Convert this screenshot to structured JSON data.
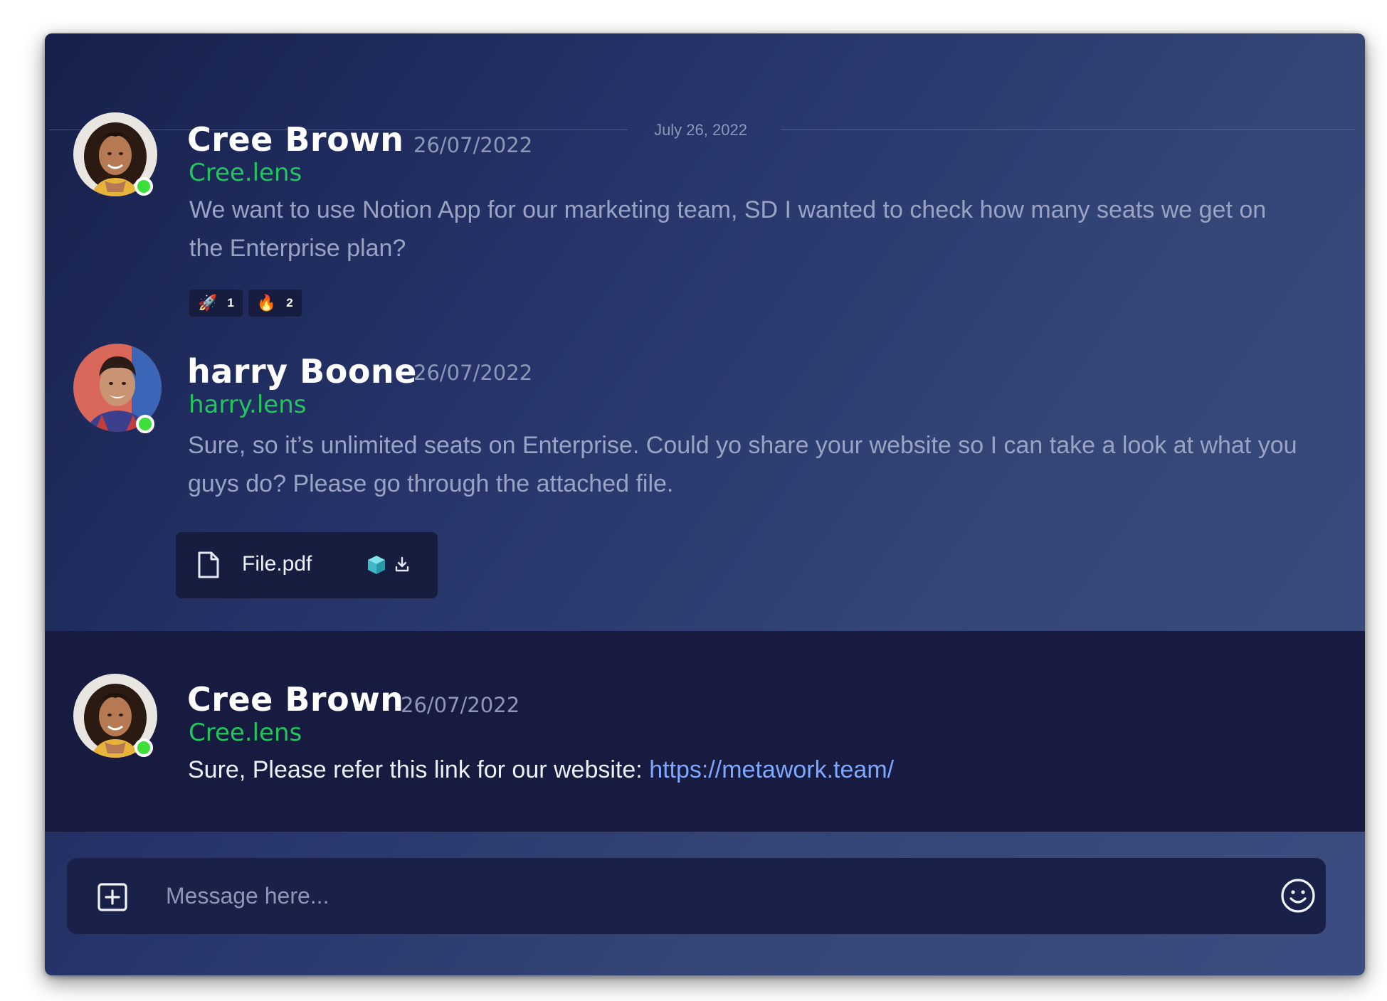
{
  "date_divider": "July 26, 2022",
  "messages": [
    {
      "name": "Cree Brown",
      "date": "26/07/2022",
      "handle": "Cree.lens",
      "text": "We want to use Notion App for our marketing team, SD I wanted to check how many seats we get on the Enterprise plan?",
      "online": true,
      "reactions": [
        {
          "emoji": "🚀",
          "icon": "rocket-icon",
          "count": "1"
        },
        {
          "emoji": "🔥",
          "icon": "fire-icon",
          "count": "2"
        }
      ]
    },
    {
      "name": "harry Boone",
      "date": "26/07/2022",
      "handle": "harry.lens",
      "text": "Sure, so it’s unlimited seats on Enterprise. Could yo share your website so I can take a look at what you guys do? Please go through the attached file.",
      "online": true,
      "attachment": {
        "file_name": "File.pdf",
        "file_icon": "document-icon",
        "cube_icon": "cube-icon",
        "download_icon": "download-icon"
      }
    },
    {
      "name": "Cree Brown",
      "date": "26/07/2022",
      "handle": "Cree.lens",
      "text": "Sure, Please refer this link for our website: ",
      "link": "https://metawork.team/",
      "online": true,
      "highlighted": true
    }
  ],
  "composer": {
    "placeholder": "Message here...",
    "add_icon": "add-square-icon",
    "emoji_icon": "smile-icon"
  },
  "colors": {
    "handle": "#22c55e",
    "link": "#7ea8ff",
    "online": "#3de03b",
    "highlight": "#161b3f"
  }
}
